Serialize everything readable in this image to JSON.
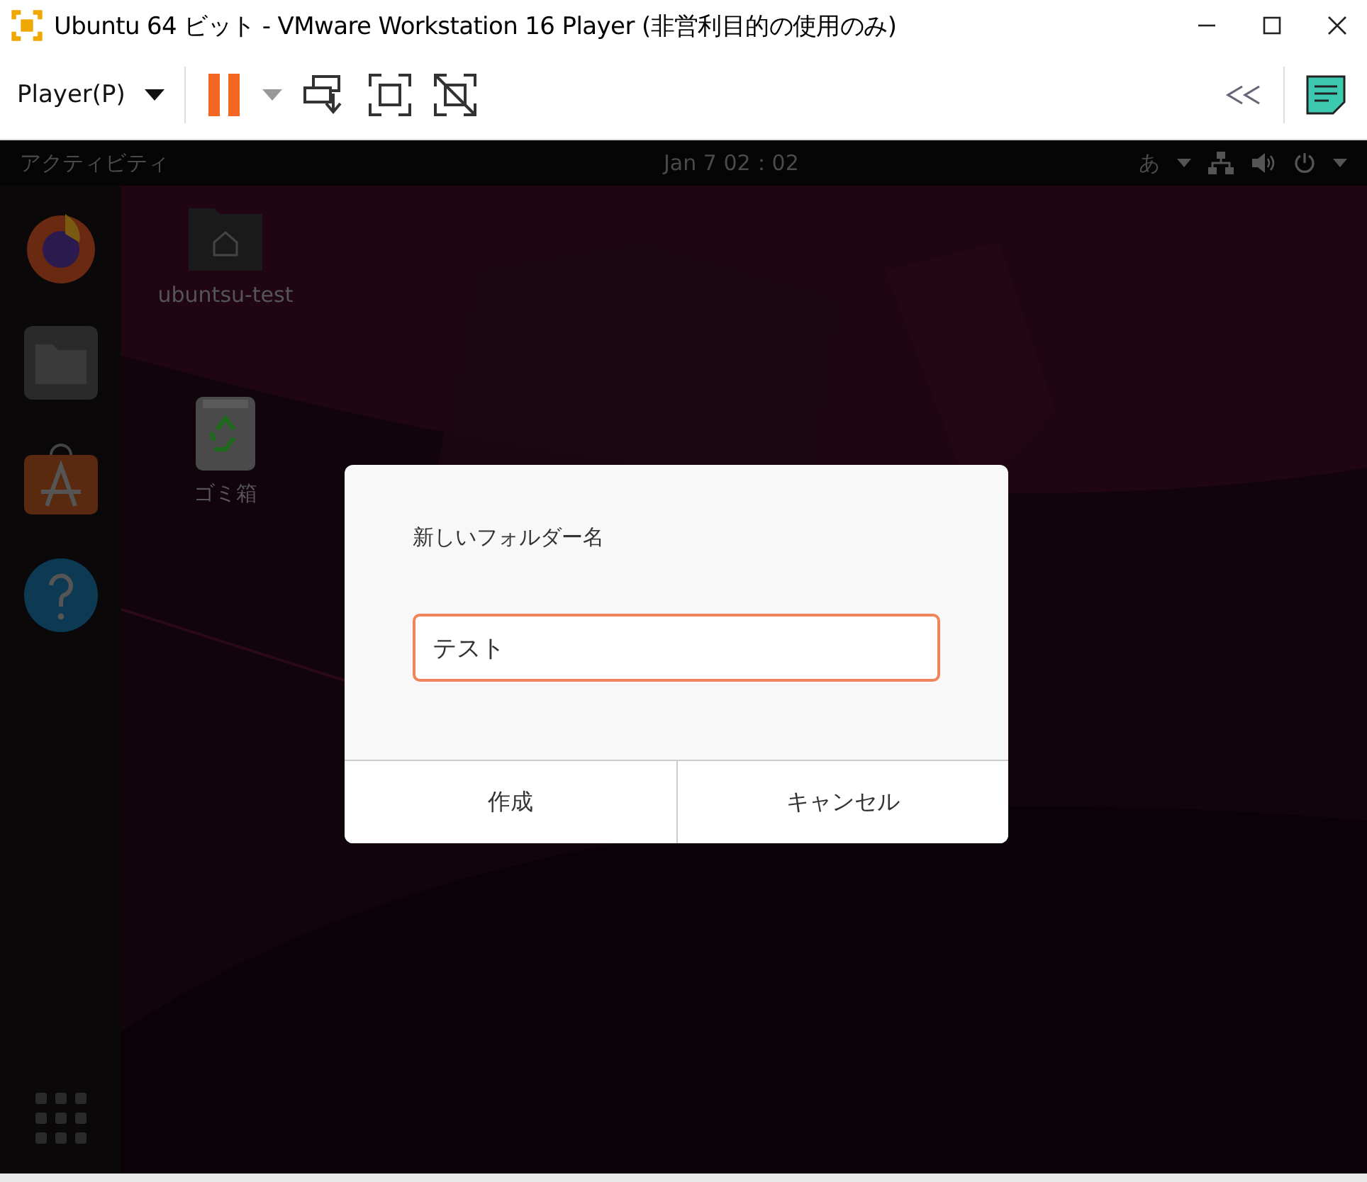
{
  "window": {
    "title": "Ubuntu 64 ビット - VMware Workstation 16 Player (非営利目的の使用のみ)"
  },
  "toolbar": {
    "menu": "Player(P)"
  },
  "top_bar": {
    "activities": "アクティビティ",
    "clock": "Jan 7  02：02",
    "input_method": "あ"
  },
  "desktop_icons": [
    {
      "label": "ubuntsu-test",
      "kind": "home"
    },
    {
      "label": "ゴミ箱",
      "kind": "trash"
    }
  ],
  "dialog": {
    "title": "新しいフォルダー名",
    "value": "テスト",
    "buttons": [
      "作成",
      "キャンセル"
    ]
  }
}
